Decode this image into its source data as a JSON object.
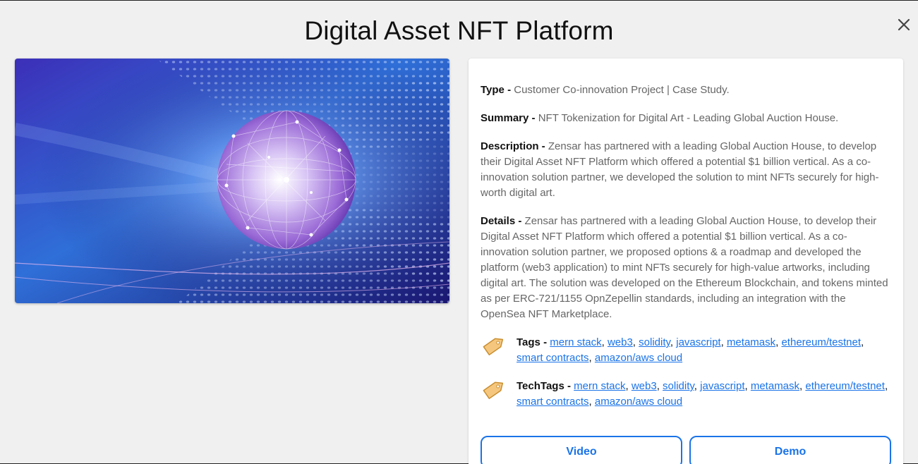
{
  "modal": {
    "title": "Digital Asset NFT Platform"
  },
  "details": {
    "type_label": "Type -",
    "type_value": "Customer Co-innovation Project | Case Study.",
    "summary_label": "Summary -",
    "summary_value": "NFT Tokenization for Digital Art - Leading Global Auction House.",
    "description_label": "Description -",
    "description_value": "Zensar has partnered with a leading Global Auction House, to develop their Digital Asset NFT Platform which offered a potential $1 billion vertical. As a co-innovation solution partner, we developed the solution to mint NFTs securely for high-worth digital art.",
    "details_label": "Details -",
    "details_value": "Zensar has partnered with a leading Global Auction House, to develop their Digital Asset NFT Platform which offered a potential $1 billion vertical. As a co-innovation solution partner, we proposed options & a roadmap and developed the platform (web3 application) to mint NFTs securely for high-value artworks, including digital art. The solution was developed on the Ethereum Blockchain, and tokens minted as per ERC-721/1155 OpnZepellin standards, including an integration with the OpenSea NFT Marketplace."
  },
  "tags": {
    "label": "Tags -",
    "items": [
      "mern stack",
      "web3",
      "solidity",
      "javascript",
      "metamask",
      "ethereum/testnet",
      "smart contracts",
      "amazon/aws cloud"
    ]
  },
  "techtags": {
    "label": "TechTags -",
    "items": [
      "mern stack",
      "web3",
      "solidity",
      "javascript",
      "metamask",
      "ethereum/testnet",
      "smart contracts",
      "amazon/aws cloud"
    ]
  },
  "buttons": {
    "video": "Video",
    "demo": "Demo"
  },
  "icons": {
    "close": "close-icon",
    "tag": "tag-icon"
  },
  "colors": {
    "accent": "#1a73e8",
    "tag_fill": "#f5c77e",
    "background": "#f0f0f0"
  }
}
